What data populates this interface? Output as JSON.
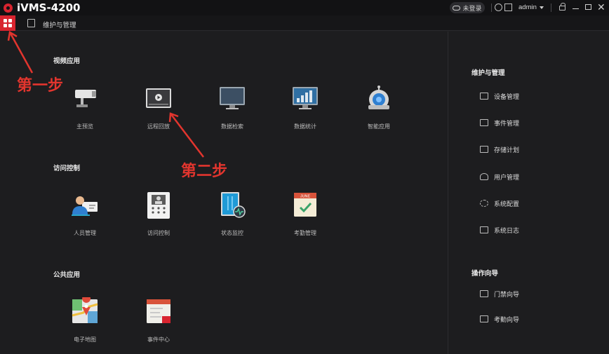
{
  "window": {
    "title": "iVMS-4200",
    "login_status": "未登录",
    "user": "admin",
    "accent_color": "#d8242f"
  },
  "tabbar": {
    "tab_label": "维护与管理"
  },
  "sections": {
    "video": {
      "title": "视频应用",
      "items": [
        "主预览",
        "远程回放",
        "数据检索",
        "数据统计",
        "智能应用"
      ]
    },
    "access": {
      "title": "访问控制",
      "items": [
        "人员管理",
        "访问控制",
        "状态监控",
        "考勤管理"
      ]
    },
    "public": {
      "title": "公共应用",
      "items": [
        "电子地图",
        "事件中心"
      ]
    }
  },
  "calendar": {
    "month": "JUNE"
  },
  "sidebar": {
    "maintenance_title": "维护与管理",
    "maintenance_items": [
      "设备管理",
      "事件管理",
      "存储计划",
      "用户管理",
      "系统配置",
      "系统日志"
    ],
    "guide_title": "操作向导",
    "guide_items": [
      "门禁向导",
      "考勤向导"
    ]
  },
  "annotations": {
    "step1": "第一步",
    "step2": "第二步",
    "color": "#e2352e"
  }
}
